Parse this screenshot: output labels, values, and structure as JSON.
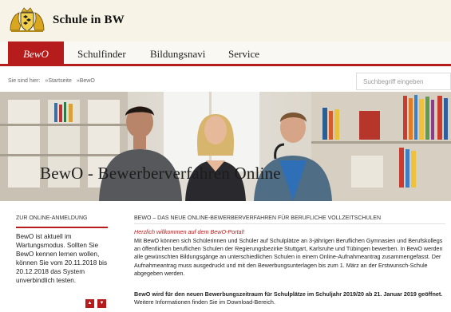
{
  "header": {
    "site_title": "Schule in BW",
    "logo_icon": "coat-of-arms-icon"
  },
  "nav": {
    "items": [
      "BewO",
      "Schulfinder",
      "Bildungsnavi",
      "Service"
    ],
    "active": "BewO",
    "accent": "#b71c1c"
  },
  "breadcrumb": {
    "prefix": "Sie sind hier:",
    "items": [
      "»Startseite",
      "»BewO"
    ]
  },
  "search": {
    "placeholder": "Suchbegriff eingeben"
  },
  "hero": {
    "title": "BewO - Bewerberverfahren Online"
  },
  "sidebar": {
    "title": "ZUR ONLINE-ANMELDUNG",
    "text": "BewO ist aktuell im Wartungsmodus. Sollten Sie BewO kennen lernen wollen, können Sie vom 20.11.2018 bis 20.12.2018 das System unverbindlich testen.",
    "prev_icon": "triangle-up-icon",
    "next_icon": "triangle-down-icon",
    "prev_glyph": "▲",
    "next_glyph": "▼"
  },
  "main": {
    "title": "BEWO – DAS NEUE ONLINE-BEWERBERVERFAHREN FÜR BERUFLICHE VOLLZEITSCHULEN",
    "intro": "Herzlich willkommen auf dem BewO-Portal!",
    "body": "Mit BewO können sich Schülerinnen und Schüler auf Schulplätze an 3-jährigen Beruflichen Gymnasien und Berufskollegs an öffentlichen beruflichen Schulen der Regierungsbezirke Stuttgart, Karlsruhe und Tübingen bewerben. In BewO werden alle gewünschten Bildungsgänge an unterschiedlichen Schulen in einem Online-Aufnahmeantrag zusammengefasst. Der Aufnahmeantrag muss ausgedruckt und mit den Bewerbungsunterlagen bis zum 1. März an der Erstwunsch-Schule abgegeben werden.",
    "strong": "BewO wird für den neuen Bewerbungszeitraum für Schulplätze im Schuljahr 2019/20 ab 21. Januar 2019 geöffnet.",
    "tail": " Weitere Informationen finden Sie im Download-Bereich."
  }
}
